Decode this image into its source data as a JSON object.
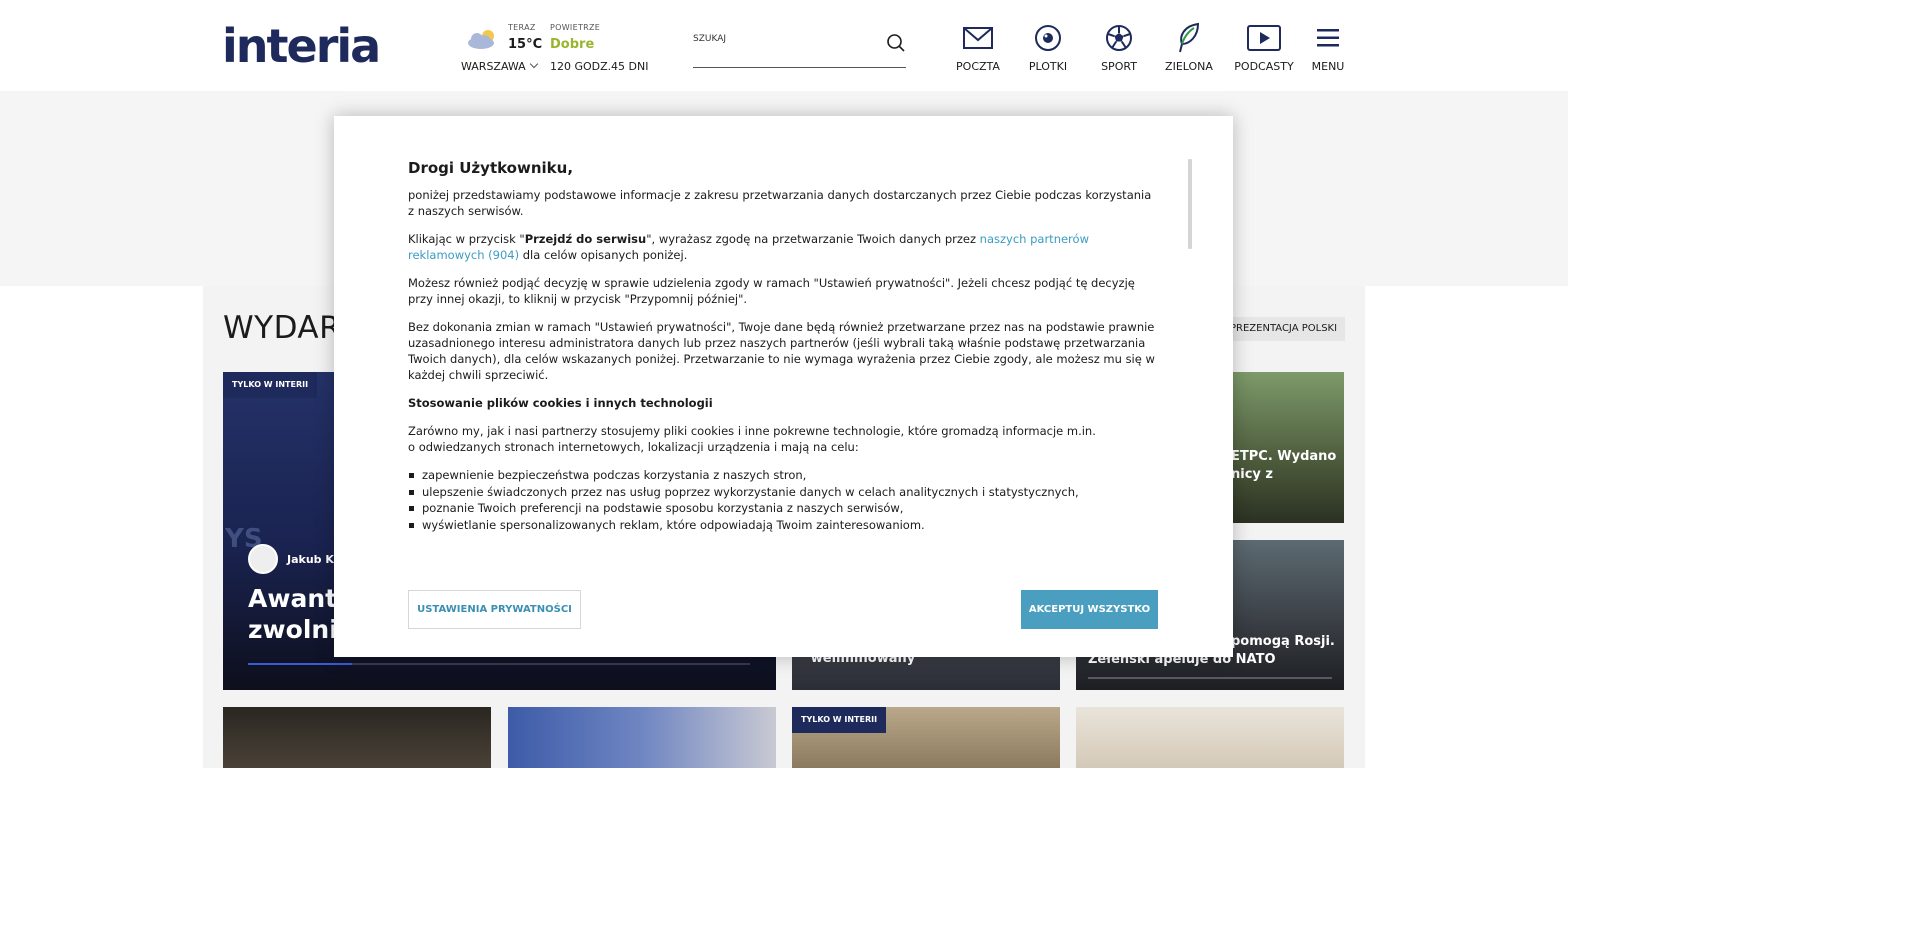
{
  "header": {
    "logo": "interia",
    "weather": {
      "now_label": "TERAZ",
      "temperature": "15°C",
      "air_label": "POWIETRZE",
      "air_quality": "Dobre",
      "city": "WARSZAWA",
      "link_120h": "120 GODZ.",
      "link_45d": "45 DNI"
    },
    "search": {
      "placeholder": "SZUKAJ"
    },
    "nav": [
      {
        "label": "POCZTA",
        "icon": "mail-icon"
      },
      {
        "label": "PLOTKI",
        "icon": "eye-icon"
      },
      {
        "label": "SPORT",
        "icon": "soccer-ball-icon"
      },
      {
        "label": "ZIELONA",
        "icon": "leaf-icon"
      },
      {
        "label": "PODCASTY",
        "icon": "play-icon"
      },
      {
        "label": "MENU",
        "icon": "hamburger-icon"
      }
    ]
  },
  "page": {
    "section_title": "WYDARZ",
    "tag_pill": "PREZENTACJA POLSKI",
    "tiles": {
      "main_badge": "TYLKO W INTERII",
      "main_author": "Jakub Krz",
      "main_title_line1": "Awantu",
      "main_title_line2": "zwolnie",
      "top_right_line1": "ETPC. Wydano",
      "top_right_line2": "nicy z",
      "mid_line": "\"weliminowany\"",
      "right_line1": "pomogą Rosji.",
      "right_line2": "Zełenski apeluje do NATO",
      "bottom_badge": "TYLKO W INTERII"
    }
  },
  "consent_modal": {
    "title": "Drogi Użytkowniku,",
    "p1": "poniżej przedstawiamy podstawowe informacje z zakresu przetwarzania danych dostarczanych przez Ciebie podczas korzystania z naszych serwisów.",
    "p2_before": "Klikając w przycisk \"",
    "p2_bold": "Przejdź do serwisu",
    "p2_middle": "\", wyrażasz zgodę na przetwarzanie Twoich danych przez ",
    "p2_link": "naszych partnerów reklamowych (904)",
    "p2_after": " dla celów opisanych poniżej.",
    "p3": "Możesz również podjąć decyzję w sprawie udzielenia zgody w ramach \"Ustawień prywatności\". Jeżeli chcesz podjąć tę decyzję przy innej okazji, to kliknij w przycisk \"Przypomnij później\".",
    "p4": "Bez dokonania zmian w ramach \"Ustawień prywatności\", Twoje dane będą również przetwarzane przez nas na podstawie prawnie uzasadnionego interesu administratora danych lub przez naszych partnerów (jeśli wybrali taką właśnie podstawę przetwarzania Twoich danych), dla celów wskazanych poniżej. Przetwarzanie to nie wymaga wyrażenia przez Ciebie zgody, ale możesz mu się w każdej chwili sprzeciwić.",
    "heading": "Stosowanie plików cookies i innych technologii",
    "p5_line1": "Zarówno my, jak i  nasi partnerzy stosujemy pliki cookies i inne pokrewne technologie, które gromadzą informacje m.in.",
    "p5_line2": "o odwiedzanych stronach internetowych, lokalizacji urządzenia i mają na celu:",
    "bullets": [
      "zapewnienie bezpieczeństwa podczas korzystania z naszych stron,",
      "ulepszenie świadczonych przez nas usług poprzez wykorzystanie danych w celach analitycznych i statystycznych,",
      "poznanie Twoich preferencji na podstawie sposobu korzystania z naszych serwisów,",
      "wyświetlanie spersonalizowanych reklam, które odpowiadają Twoim zainteresowaniom."
    ],
    "btn_settings": "USTAWIENIA PRYWATNOŚCI",
    "btn_accept": "AKCEPTUJ WSZYSTKO"
  },
  "colors": {
    "brand": "#1e2a5c",
    "accent": "#4a9fc1",
    "link": "#3b9cc2",
    "air_good": "#9ab52c"
  }
}
